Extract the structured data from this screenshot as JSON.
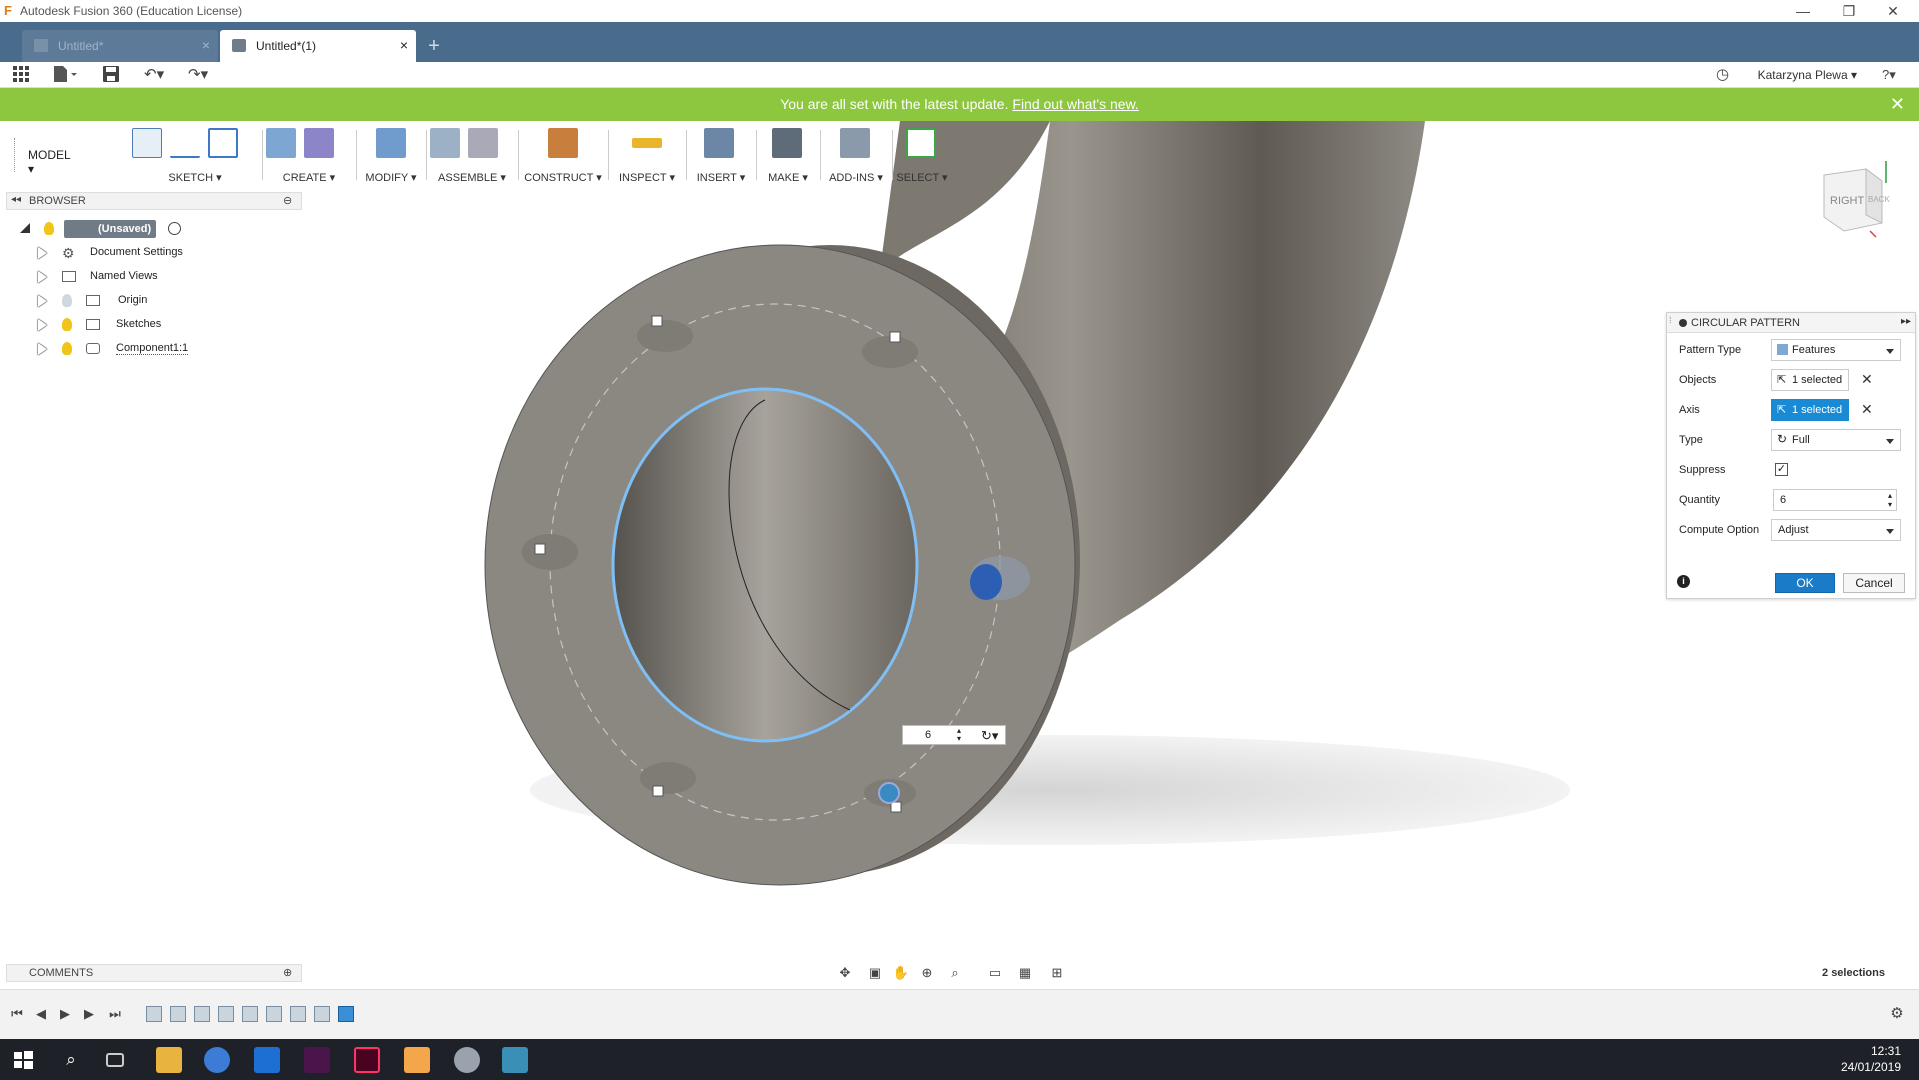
{
  "window": {
    "title": "Autodesk Fusion 360 (Education License)",
    "minimize": "—",
    "restore": "❐",
    "close": "✕"
  },
  "tabs": [
    {
      "label": "Untitled*",
      "active": false
    },
    {
      "label": "Untitled*(1)",
      "active": true
    }
  ],
  "tab_add": "+",
  "qat": {
    "user": "Katarzyna Plewa ▾",
    "help": "?▾"
  },
  "banner": {
    "message": "You are all set with the latest update.",
    "link": "Find out what's new.",
    "close": "✕"
  },
  "toolbar": {
    "workspace": "MODEL ▾",
    "groups": [
      {
        "label": "SKETCH ▾"
      },
      {
        "label": "CREATE ▾"
      },
      {
        "label": "MODIFY ▾"
      },
      {
        "label": "ASSEMBLE ▾"
      },
      {
        "label": "CONSTRUCT ▾"
      },
      {
        "label": "INSPECT ▾"
      },
      {
        "label": "INSERT ▾"
      },
      {
        "label": "MAKE ▾"
      },
      {
        "label": "ADD-INS ▾"
      },
      {
        "label": "SELECT ▾"
      }
    ]
  },
  "browser": {
    "title": "BROWSER",
    "root": "(Unsaved)",
    "items": [
      {
        "label": "Document Settings"
      },
      {
        "label": "Named Views"
      },
      {
        "label": "Origin"
      },
      {
        "label": "Sketches"
      },
      {
        "label": "Component1:1"
      }
    ]
  },
  "viewcube": {
    "right": "RIGHT",
    "back": "BACK"
  },
  "canvas_input": {
    "quantity": "6"
  },
  "dialog": {
    "title": "CIRCULAR PATTERN",
    "rows": {
      "pattern_type": {
        "label": "Pattern Type",
        "value": "Features"
      },
      "objects": {
        "label": "Objects",
        "value": "1 selected"
      },
      "axis": {
        "label": "Axis",
        "value": "1 selected"
      },
      "type": {
        "label": "Type",
        "value": "Full"
      },
      "suppress": {
        "label": "Suppress",
        "checked": true
      },
      "quantity": {
        "label": "Quantity",
        "value": "6"
      },
      "compute_option": {
        "label": "Compute Option",
        "value": "Adjust"
      }
    },
    "ok": "OK",
    "cancel": "Cancel"
  },
  "comments": {
    "title": "COMMENTS"
  },
  "status": {
    "selections": "2 selections"
  },
  "taskbar": {
    "time": "12:31",
    "date": "24/01/2019"
  },
  "colors": {
    "tab_bar": "#4a6c8c",
    "banner": "#8dc63f",
    "accent": "#1a8ad4",
    "model_grey": "#8a8782",
    "selection_blue": "#6fb3f0"
  }
}
